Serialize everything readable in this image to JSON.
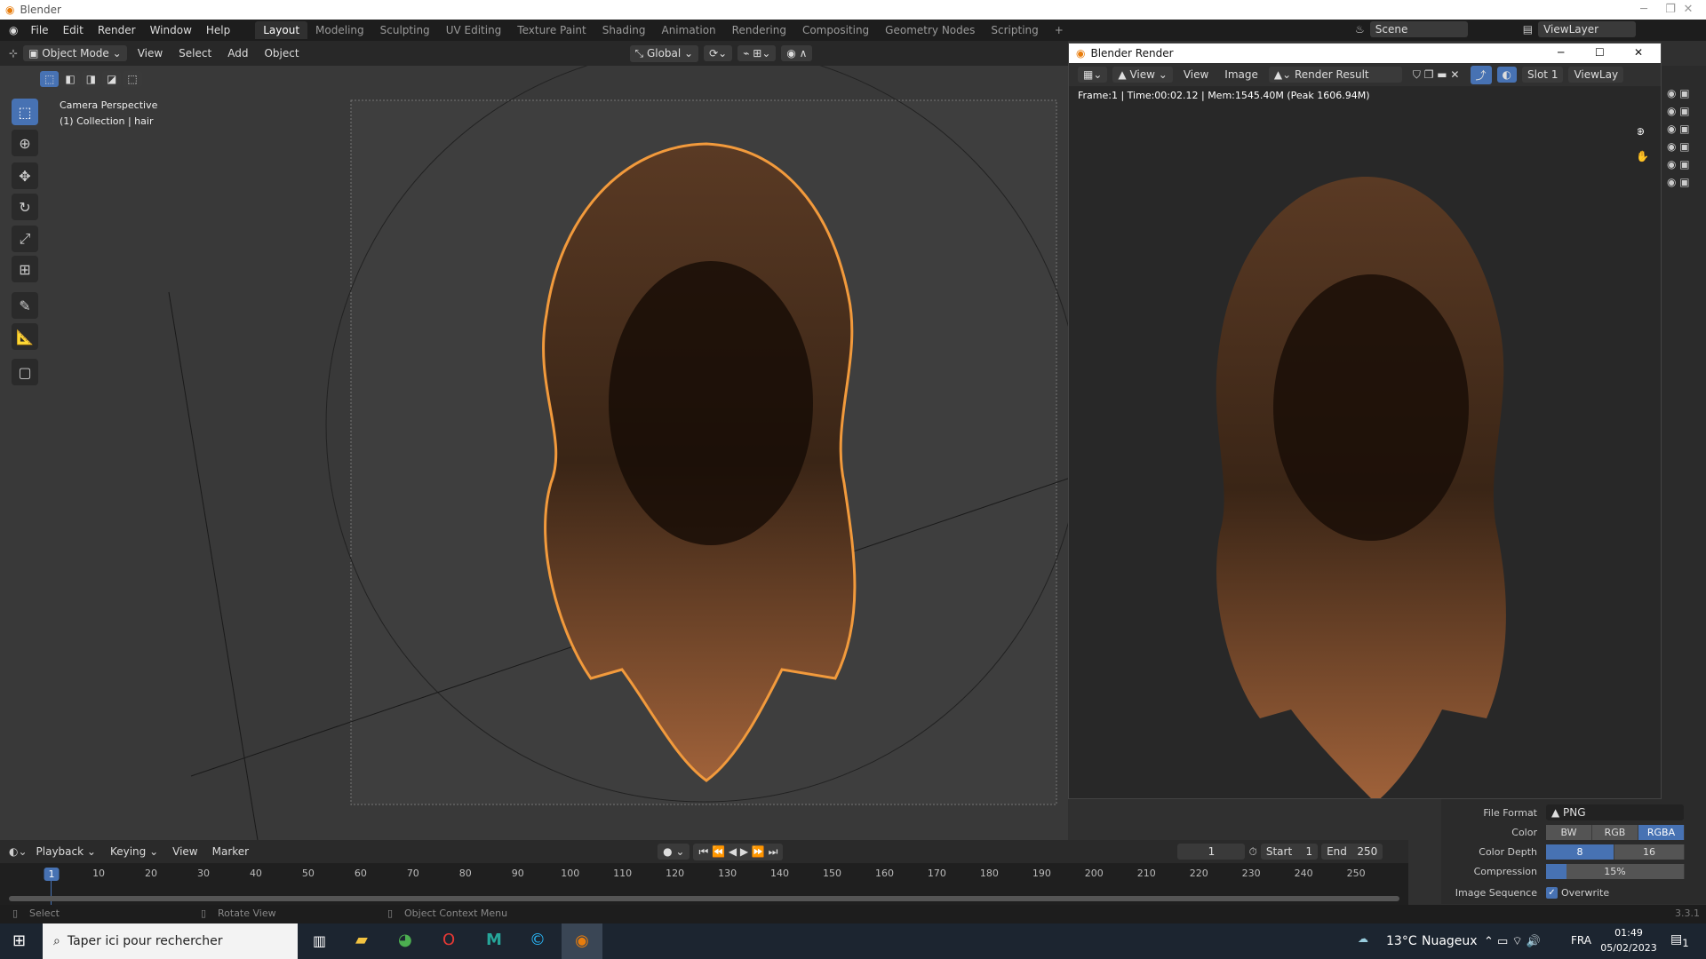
{
  "app": {
    "title": "Blender",
    "version": "3.3.1"
  },
  "menu": [
    "File",
    "Edit",
    "Render",
    "Window",
    "Help"
  ],
  "workspaces": [
    "Layout",
    "Modeling",
    "Sculpting",
    "UV Editing",
    "Texture Paint",
    "Shading",
    "Animation",
    "Rendering",
    "Compositing",
    "Geometry Nodes",
    "Scripting",
    "+"
  ],
  "scene": {
    "name": "Scene",
    "view_layer": "ViewLayer"
  },
  "viewport_header": {
    "mode": "Object Mode",
    "items": [
      "View",
      "Select",
      "Add",
      "Object"
    ],
    "orientation": "Global"
  },
  "viewport": {
    "camera_label": "Camera Perspective",
    "collection_label": "(1) Collection | hair"
  },
  "render_window": {
    "title": "Blender Render",
    "view_menu": "View",
    "menus": [
      "View",
      "Image"
    ],
    "image_name": "Render Result",
    "slot": "Slot 1",
    "view_layer": "ViewLay",
    "info": "Frame:1 | Time:00:02.12 | Mem:1545.40M (Peak 1606.94M)"
  },
  "output_props": {
    "file_format_label": "File Format",
    "file_format": "PNG",
    "color_label": "Color",
    "color_options": [
      "BW",
      "RGB",
      "RGBA"
    ],
    "color_selected": "RGBA",
    "depth_label": "Color Depth",
    "depth_options": [
      "8",
      "16"
    ],
    "depth_selected": "8",
    "compression_label": "Compression",
    "compression": "15%",
    "compression_value": 15,
    "sequence_label": "Image Sequence",
    "overwrite_label": "Overwrite",
    "overwrite": true
  },
  "timeline": {
    "menus": [
      "Playback",
      "Keying",
      "View",
      "Marker"
    ],
    "current_frame": "1",
    "start_label": "Start",
    "start": "1",
    "end_label": "End",
    "end": "250",
    "ticks": [
      "1",
      "10",
      "20",
      "30",
      "40",
      "50",
      "60",
      "70",
      "80",
      "90",
      "100",
      "110",
      "120",
      "130",
      "140",
      "150",
      "160",
      "170",
      "180",
      "190",
      "200",
      "210",
      "220",
      "230",
      "240",
      "250"
    ]
  },
  "statusbar": {
    "select": "Select",
    "rotate": "Rotate View",
    "context": "Object Context Menu"
  },
  "taskbar": {
    "search_placeholder": "Taper ici pour rechercher",
    "weather_temp": "13°C",
    "weather_text": "Nuageux",
    "lang": "FRA",
    "time": "01:49",
    "date": "05/02/2023",
    "notifications": "1"
  }
}
